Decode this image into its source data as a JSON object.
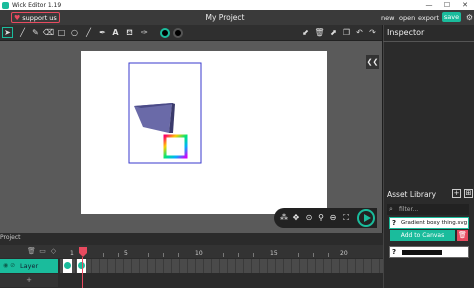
{
  "window": {
    "title": "Wick Editor 1.19",
    "minimize": "—",
    "maximize": "☐",
    "close": "✕"
  },
  "menubar": {
    "support_label": "support us",
    "project_title": "My Project",
    "new": "new",
    "open": "open",
    "export": "export",
    "save": "save"
  },
  "toolbar": {
    "tools": [
      "cursor-icon",
      "brush-icon",
      "pencil-icon",
      "eraser-icon",
      "rectangle-icon",
      "ellipse-icon",
      "line-icon",
      "pen-icon",
      "text-icon",
      "fill-bucket-icon",
      "eyedropper-icon"
    ],
    "fill_color": "#1abc9c",
    "stroke_color": "#000000",
    "actions": [
      "send-backward-icon",
      "delete-icon",
      "bring-forward-icon",
      "copy-icon",
      "undo-icon",
      "redo-icon",
      "settings-icon"
    ]
  },
  "inspector": {
    "title": "Inspector",
    "collapse_label": "❮❮"
  },
  "asset_library": {
    "title": "Asset Library",
    "filter_placeholder": "filter...",
    "selected_asset": "Gradient boxy thing.svg",
    "add_to_canvas": "Add to Canvas"
  },
  "timeline": {
    "tab": "Project",
    "layer_name": "Layer",
    "frame_numbers": [
      "1",
      "5",
      "10",
      "15",
      "20"
    ],
    "add_layer": "+"
  },
  "colors": {
    "accent": "#1abc9c",
    "danger": "#e84a5f"
  }
}
